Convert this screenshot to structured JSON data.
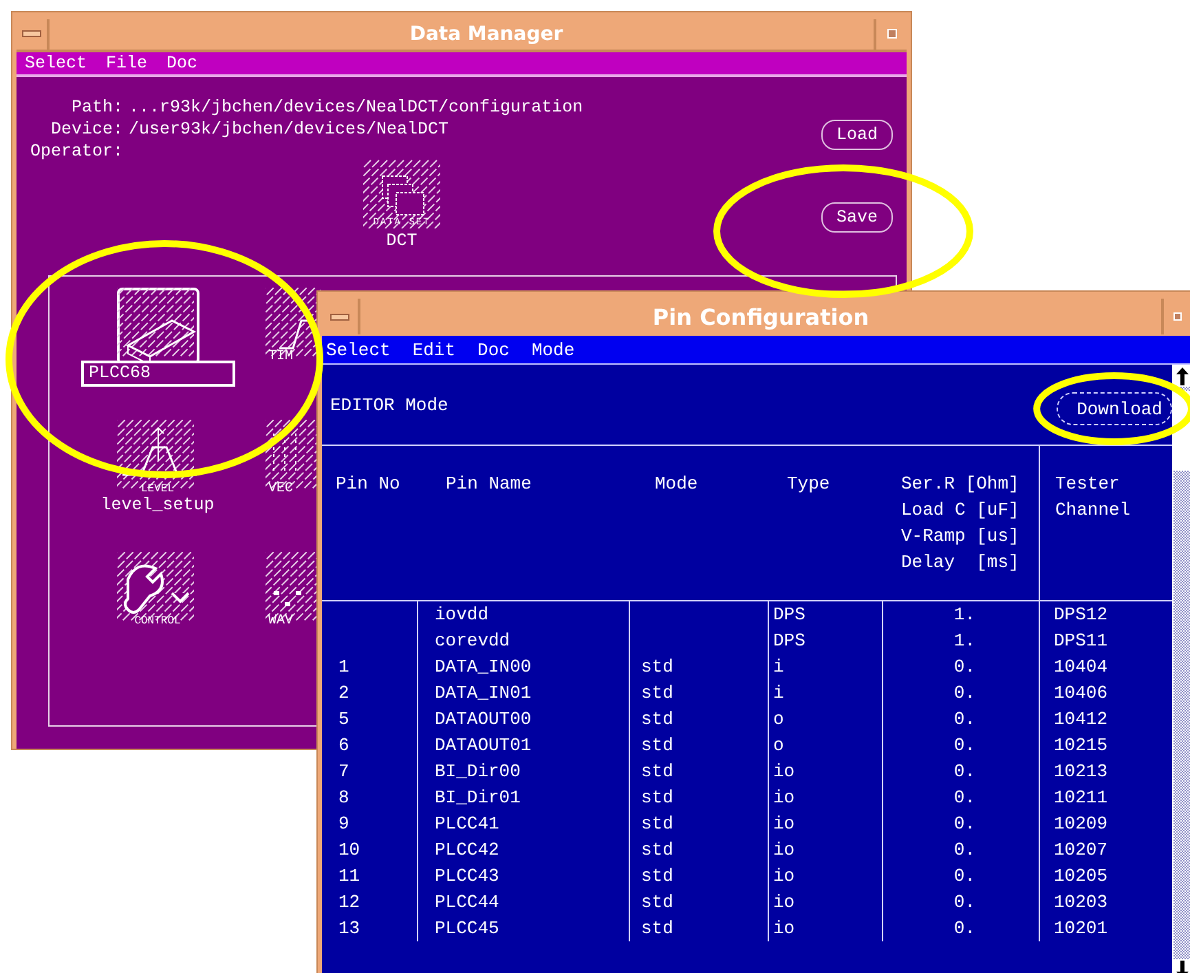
{
  "data_manager": {
    "title": "Data Manager",
    "menu": [
      "Select",
      "File",
      "Doc"
    ],
    "fields": [
      {
        "label": "Path:",
        "value": "...r93k/jbchen/devices/NealDCT/configuration"
      },
      {
        "label": "Device:",
        "value": "/user93k/jbchen/devices/NealDCT"
      },
      {
        "label": "Operator:"
      }
    ],
    "dataset": {
      "caption": "DATA SET",
      "name": "DCT"
    },
    "buttons": [
      {
        "label": "Load",
        "highlight": false
      },
      {
        "label": "Save",
        "highlight": true
      }
    ],
    "icons": [
      {
        "kind": "chip",
        "value": "PLCC68",
        "highlight": true
      },
      {
        "kind": "timing",
        "caption": "TIM"
      },
      {
        "kind": "level",
        "caption": "LEVEL",
        "name": "level_setup"
      },
      {
        "kind": "vector",
        "caption": "VEC"
      },
      {
        "kind": "control",
        "caption": "CONTROL"
      },
      {
        "kind": "wave",
        "caption": "WAV"
      }
    ]
  },
  "pin_configuration": {
    "title": "Pin Configuration",
    "menu": [
      "Select",
      "Edit",
      "Doc",
      "Mode"
    ],
    "mode_label": "EDITOR Mode",
    "download": {
      "label": "Download",
      "highlight": true
    },
    "columns": [
      "Pin No",
      "Pin Name",
      "Mode",
      "Type",
      "Ser.R [Ohm]\nLoad C [uF]\nV-Ramp [us]\nDelay  [ms]",
      "Tester\nChannel"
    ],
    "rows": [
      [
        "",
        "iovdd",
        "",
        "DPS",
        "1.",
        "DPS12"
      ],
      [
        "",
        "corevdd",
        "",
        "DPS",
        "1.",
        "DPS11"
      ],
      [
        "1",
        "DATA_IN00",
        "std",
        "i",
        "0.",
        "10404"
      ],
      [
        "2",
        "DATA_IN01",
        "std",
        "i",
        "0.",
        "10406"
      ],
      [
        "5",
        "DATAOUT00",
        "std",
        "o",
        "0.",
        "10412"
      ],
      [
        "6",
        "DATAOUT01",
        "std",
        "o",
        "0.",
        "10215"
      ],
      [
        "7",
        "BI_Dir00",
        "std",
        "io",
        "0.",
        "10213"
      ],
      [
        "8",
        "BI_Dir01",
        "std",
        "io",
        "0.",
        "10211"
      ],
      [
        "9",
        "PLCC41",
        "std",
        "io",
        "0.",
        "10209"
      ],
      [
        "10",
        "PLCC42",
        "std",
        "io",
        "0.",
        "10207"
      ],
      [
        "11",
        "PLCC43",
        "std",
        "io",
        "0.",
        "10205"
      ],
      [
        "12",
        "PLCC44",
        "std",
        "io",
        "0.",
        "10203"
      ],
      [
        "13",
        "PLCC45",
        "std",
        "io",
        "0.",
        "10201"
      ]
    ]
  }
}
